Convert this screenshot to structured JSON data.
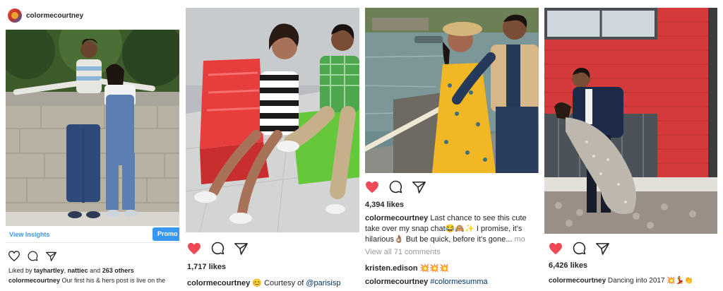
{
  "panels": [
    {
      "username": "colormecourtney",
      "view_insights": "View Insights",
      "promote": "Promo",
      "liked_by_prefix": "Liked by",
      "liked_by_user1": "tayhartley",
      "liked_by_sep": ",",
      "liked_by_user2": "nattiec",
      "liked_by_and": "and",
      "liked_by_count": "263 others",
      "caption_user": "colormecourtney",
      "caption_text": "Our first his & hers post is live on the"
    },
    {
      "likes": "1,717 likes",
      "caption_user": "colormecourtney",
      "caption_emoji": "😊",
      "caption_text": "Courtesy of",
      "caption_mention": "@parisisp"
    },
    {
      "likes": "4,394 likes",
      "caption_user": "colormecourtney",
      "caption_line1": "Last chance to see this cute",
      "caption_line2": "take over my snap chat😂🙈✨ I promise, it's",
      "caption_line3": "hilarious👌🏽 But be quick, before it's gone...",
      "more": "mo",
      "view_comments": "View all 71 comments",
      "comment_user": "kristen.edison",
      "comment_text": "💥💥💥",
      "caption2_user": "colormecourtney",
      "caption2_tag": "#colormesumma"
    },
    {
      "likes": "6,426 likes",
      "caption_user": "colormecourtney",
      "caption_text": "Dancing into 2017 💥💃👏"
    }
  ],
  "colors": {
    "heart": "#ed4956",
    "link_blue": "#3897f0",
    "text": "#262626",
    "grey": "#999999"
  },
  "icons": [
    "heart-icon",
    "comment-icon",
    "share-icon"
  ]
}
